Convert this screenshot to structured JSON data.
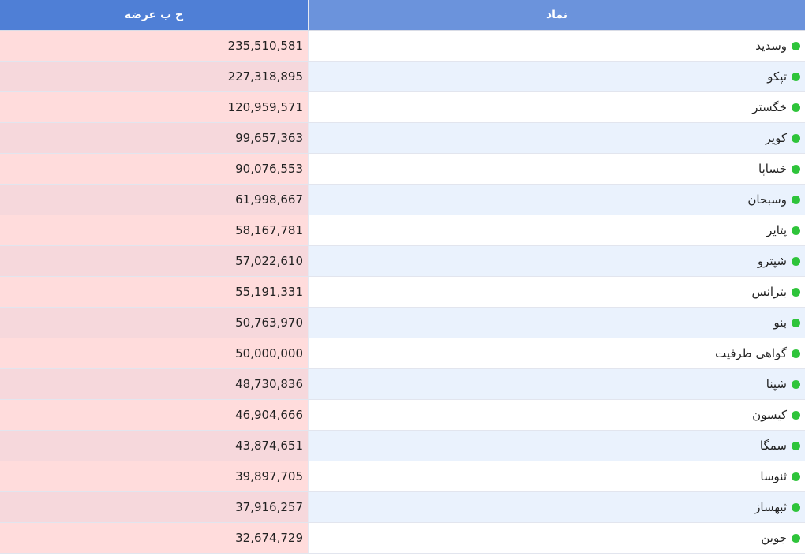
{
  "headers": {
    "volume": "ح ب عرضه",
    "symbol": "نماد"
  },
  "colors": {
    "header_left": "#4f7fd6",
    "header_right": "#6b93dc",
    "volume_cell_bg": "#ffdcdc",
    "status_dot": "#2ec43a",
    "alt_row_bg": "#eaf2fd"
  },
  "status_icon": "green-dot-icon",
  "rows": [
    {
      "symbol": "وسدید",
      "volume": "235,510,581"
    },
    {
      "symbol": "تپکو",
      "volume": "227,318,895"
    },
    {
      "symbol": "خگستر",
      "volume": "120,959,571"
    },
    {
      "symbol": "کویر",
      "volume": "99,657,363"
    },
    {
      "symbol": "خساپا",
      "volume": "90,076,553"
    },
    {
      "symbol": "وسبحان",
      "volume": "61,998,667"
    },
    {
      "symbol": "پتایر",
      "volume": "58,167,781"
    },
    {
      "symbol": "شپترو",
      "volume": "57,022,610"
    },
    {
      "symbol": "بترانس",
      "volume": "55,191,331"
    },
    {
      "symbol": "بنو",
      "volume": "50,763,970"
    },
    {
      "symbol": "گواهی ظرفیت",
      "volume": "50,000,000"
    },
    {
      "symbol": "شپنا",
      "volume": "48,730,836"
    },
    {
      "symbol": "کیسون",
      "volume": "46,904,666"
    },
    {
      "symbol": "سمگا",
      "volume": "43,874,651"
    },
    {
      "symbol": "ثنوسا",
      "volume": "39,897,705"
    },
    {
      "symbol": "ثبهساز",
      "volume": "37,916,257"
    },
    {
      "symbol": "جوین",
      "volume": "32,674,729"
    }
  ]
}
